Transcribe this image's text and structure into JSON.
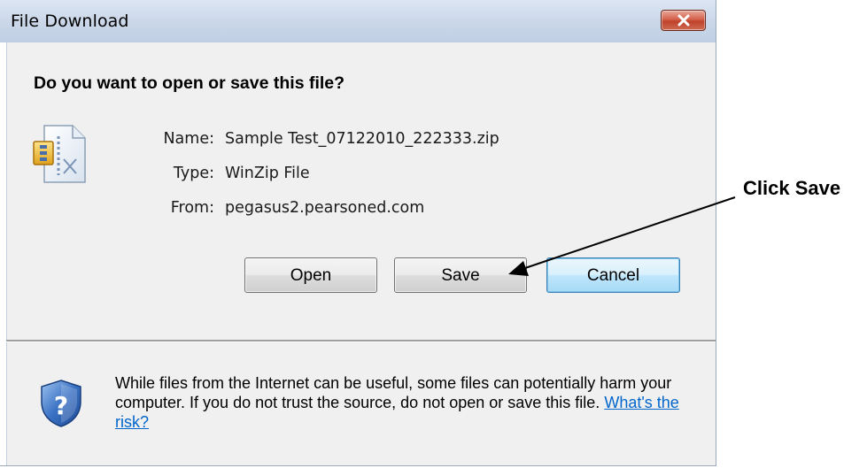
{
  "dialog": {
    "title": "File Download",
    "question": "Do you want to open or save this file?",
    "file": {
      "name_label": "Name:",
      "name_value": "Sample Test_07122010_222333.zip",
      "type_label": "Type:",
      "type_value": "WinZip File",
      "from_label": "From:",
      "from_value": "pegasus2.pearsoned.com"
    },
    "buttons": {
      "open": "Open",
      "save": "Save",
      "cancel": "Cancel"
    },
    "warning": {
      "text": "While files from the Internet can be useful, some files can potentially harm your computer. If you do not trust the source, do not open or save this file.",
      "link": "What's the risk?"
    },
    "icons": {
      "close": "close-icon",
      "file": "winzip-file-icon",
      "shield": "security-shield-icon"
    }
  },
  "annotation": {
    "label": "Click Save"
  },
  "colors": {
    "titlebar": "#cdd9ea",
    "close_button": "#c0422c",
    "panel": "#f0f0f0",
    "default_button": "#bee6fd",
    "link": "#0066cc"
  }
}
